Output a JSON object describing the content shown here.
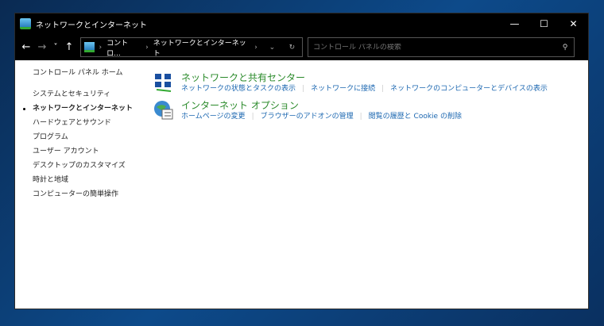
{
  "window": {
    "title": "ネットワークとインターネット",
    "minimize": "—",
    "maximize": "☐",
    "close": "✕"
  },
  "address": {
    "back": "←",
    "forward": "→",
    "recent": "˅",
    "up": "↑",
    "crumbs": [
      "コントロ...",
      "ネットワークとインターネット"
    ],
    "sep": "›",
    "dropdown": "⌄",
    "refresh": "↻"
  },
  "search": {
    "placeholder": "コントロール パネルの検索",
    "icon": "⚲"
  },
  "sidebar": {
    "home": "コントロール パネル ホーム",
    "items": [
      "システムとセキュリティ",
      "ネットワークとインターネット",
      "ハードウェアとサウンド",
      "プログラム",
      "ユーザー アカウント",
      "デスクトップのカスタマイズ",
      "時計と地域",
      "コンピューターの簡単操作"
    ],
    "current": 1
  },
  "categories": [
    {
      "title": "ネットワークと共有センター",
      "icon": "network-icon",
      "links": [
        "ネットワークの状態とタスクの表示",
        "ネットワークに接続",
        "ネットワークのコンピューターとデバイスの表示"
      ]
    },
    {
      "title": "インターネット オプション",
      "icon": "internet-options-icon",
      "links": [
        "ホームページの変更",
        "ブラウザーのアドオンの管理",
        "閲覧の履歴と Cookie の削除"
      ]
    }
  ],
  "colors": {
    "heading": "#2a8a2a",
    "link": "#1a66b0"
  }
}
